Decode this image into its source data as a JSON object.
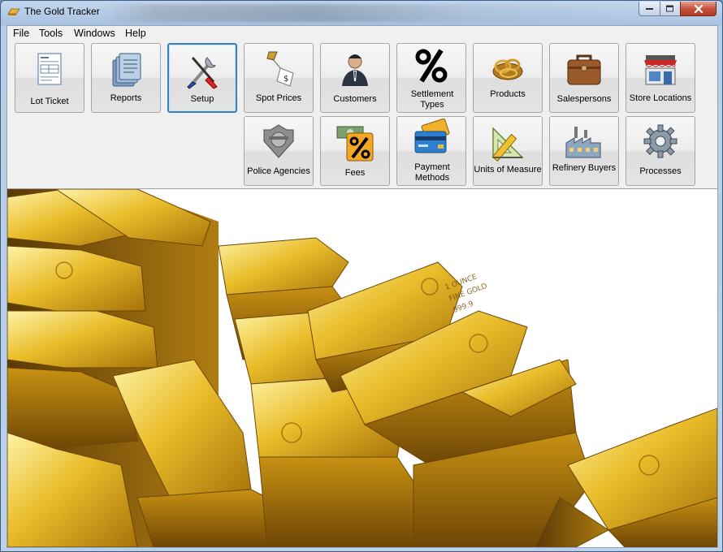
{
  "window": {
    "title": "The Gold Tracker"
  },
  "menu": [
    "File",
    "Tools",
    "Windows",
    "Help"
  ],
  "toolbar": {
    "buttons": [
      {
        "label": "Lot Ticket",
        "icon": "lot-ticket-icon"
      },
      {
        "label": "Reports",
        "icon": "reports-icon"
      },
      {
        "label": "Setup",
        "icon": "setup-tools-icon",
        "selected": true
      },
      {
        "label": "Spot Prices",
        "icon": "spot-prices-icon"
      },
      {
        "label": "Customers",
        "icon": "customer-person-icon"
      },
      {
        "label": "Settlement Types",
        "icon": "percent-icon"
      },
      {
        "label": "Products",
        "icon": "gold-jewelry-icon"
      },
      {
        "label": "Salespersons",
        "icon": "briefcase-icon"
      },
      {
        "label": "Store Locations",
        "icon": "storefront-icon"
      },
      {
        "label": "Police Agencies",
        "icon": "police-badge-icon"
      },
      {
        "label": "Fees",
        "icon": "fees-percent-money-icon"
      },
      {
        "label": "Payment Methods",
        "icon": "credit-cards-icon"
      },
      {
        "label": "Units of Measure",
        "icon": "ruler-triangle-icon"
      },
      {
        "label": "Refinery Buyers",
        "icon": "factory-icon"
      },
      {
        "label": "Processes",
        "icon": "gears-icon"
      }
    ]
  },
  "hero": {
    "description_icon": "gold-bars-image",
    "bar_stamp": [
      "1 OUNCE",
      "FINE GOLD",
      "999.9"
    ]
  }
}
